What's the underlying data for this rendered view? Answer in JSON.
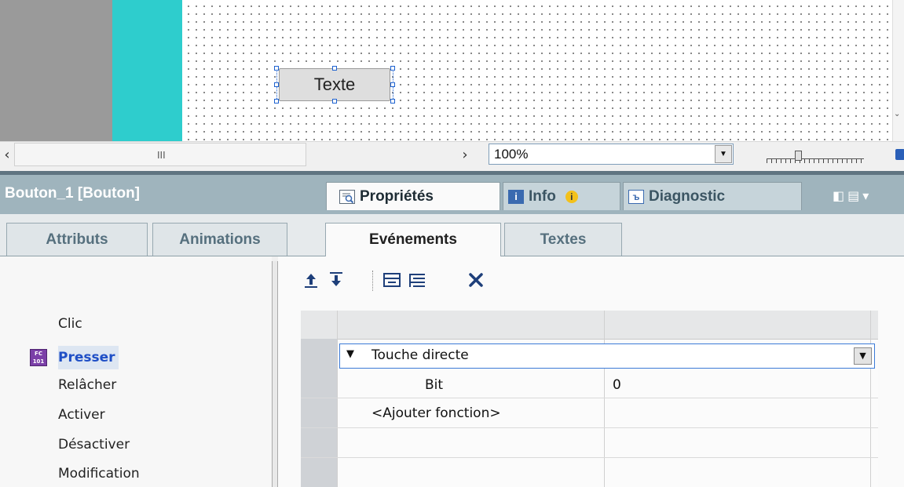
{
  "canvas": {
    "button_text": "Texte",
    "zoom": "100%",
    "hscroll_grip": "III"
  },
  "inspector": {
    "object_title": "Bouton_1 [Bouton]",
    "tabs": [
      {
        "label": "Propriétés",
        "icon": "properties-icon"
      },
      {
        "label": "Info",
        "icon": "info-icon"
      },
      {
        "label": "Diagnostic",
        "icon": "diagnostic-icon"
      }
    ]
  },
  "subtabs": [
    "Attributs",
    "Animations",
    "Evénements",
    "Textes"
  ],
  "events": {
    "items": [
      "Clic",
      "Presser",
      "Relâcher",
      "Activer",
      "Désactiver",
      "Modification"
    ],
    "selected": "Presser"
  },
  "toolbar": {
    "icons": [
      "move-up-icon",
      "move-down-icon",
      "collapse-icon",
      "expand-icon",
      "delete-icon"
    ]
  },
  "function_list": {
    "function_name": "Touche directe",
    "param_name": "Bit",
    "param_value": "0",
    "add_function": "<Ajouter fonction>"
  },
  "colors": {
    "accent_cyan": "#2ecdcd",
    "header_bg": "#9fb4bd",
    "selected_event": "#1f4fc6"
  }
}
